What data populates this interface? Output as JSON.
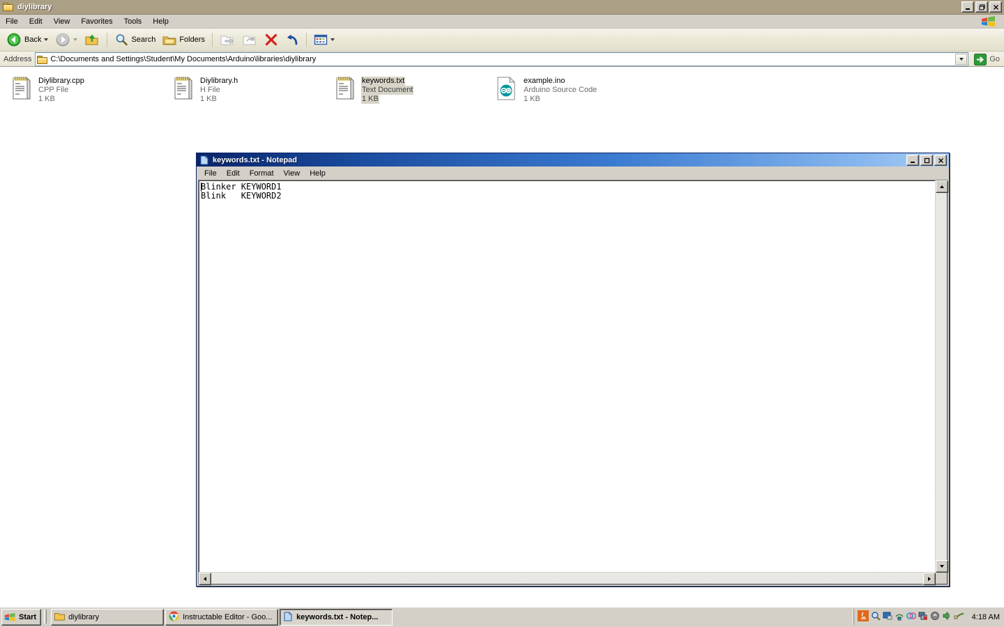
{
  "explorer": {
    "title": "diylibrary",
    "title_icon": "folder-icon",
    "window_buttons": {
      "minimize": "_",
      "restore": "□",
      "close": "✕"
    },
    "menu": [
      "File",
      "Edit",
      "View",
      "Favorites",
      "Tools",
      "Help"
    ],
    "logo_icon": "windows-flag-icon",
    "toolbar": {
      "back_label": "Back",
      "back_icon": "back-arrow-icon",
      "forward_icon": "forward-arrow-icon",
      "up_icon": "up-folder-icon",
      "search_label": "Search",
      "search_icon": "search-icon",
      "folders_label": "Folders",
      "folders_icon": "folders-icon",
      "move_to_icon": "move-to-folder-icon",
      "copy_to_icon": "copy-to-folder-icon",
      "delete_icon": "delete-x-icon",
      "undo_icon": "undo-icon",
      "views_icon": "views-icon"
    },
    "address": {
      "label": "Address",
      "path": "C:\\Documents and Settings\\Student\\My Documents\\Arduino\\libraries\\diylibrary",
      "folder_icon": "folder-icon",
      "dropdown_icon": "chevron-down-icon",
      "go_label": "Go",
      "go_icon": "go-arrow-icon"
    },
    "files": [
      {
        "name": "Diylibrary.cpp",
        "type": "CPP File",
        "size": "1 KB",
        "icon": "notepad-document-icon",
        "selected": false
      },
      {
        "name": "Diylibrary.h",
        "type": "H File",
        "size": "1 KB",
        "icon": "notepad-document-icon",
        "selected": false
      },
      {
        "name": "keywords.txt",
        "type": "Text Document",
        "size": "1 KB",
        "icon": "notepad-document-icon",
        "selected": true
      },
      {
        "name": "example.ino",
        "type": "Arduino Source Code",
        "size": "1 KB",
        "icon": "arduino-file-icon",
        "selected": false
      }
    ]
  },
  "notepad": {
    "title": "keywords.txt - Notepad",
    "title_icon": "notepad-icon",
    "window_buttons": {
      "minimize": "_",
      "maximize": "□",
      "close": "✕"
    },
    "menu": [
      "File",
      "Edit",
      "Format",
      "View",
      "Help"
    ],
    "content": "Blinker\tKEYWORD1\nBlink\tKEYWORD2",
    "scrollbars": {
      "vertical": true,
      "horizontal": true
    }
  },
  "taskbar": {
    "start_label": "Start",
    "start_icon": "windows-flag-icon",
    "buttons": [
      {
        "label": "diylibrary",
        "icon": "folder-icon",
        "active": false
      },
      {
        "label": "Instructable Editor - Goo...",
        "icon": "chrome-icon",
        "active": false
      },
      {
        "label": "keywords.txt - Notep...",
        "icon": "notepad-icon",
        "active": true
      }
    ],
    "tray_icons": [
      "java-icon",
      "magnifier-icon",
      "display-icon",
      "wireless-icon",
      "messenger-icon",
      "network-disconnected-icon",
      "shield-icon",
      "volume-icon",
      "safely-remove-hardware-icon"
    ],
    "clock": "4:18 AM"
  },
  "colors": {
    "desktop": "#ffffff",
    "chrome_face": "#d4d0c8",
    "explorer_title": "#ab9f85",
    "notepad_title_start": "#0a246a",
    "notepad_title_end": "#a8cdf5",
    "selection": "#d8d4c8",
    "arduino_teal": "#00979c",
    "toolbar_bg": "#ece9d8"
  }
}
